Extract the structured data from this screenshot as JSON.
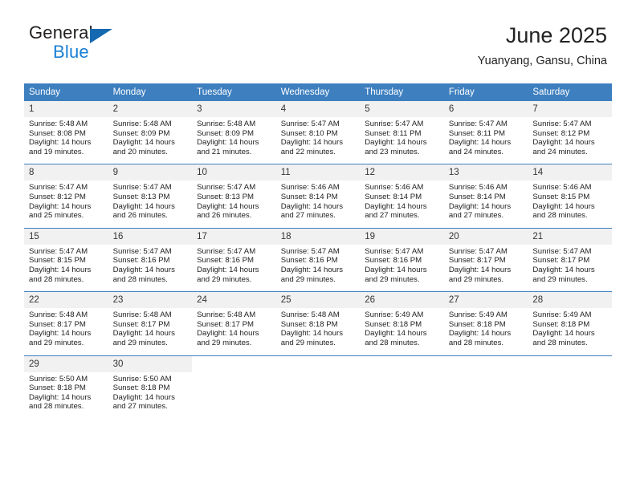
{
  "brand": {
    "name_top": "General",
    "name_bottom": "Blue",
    "accent_blue": "#1a7fd4",
    "triangle_blue": "#1569b0"
  },
  "header": {
    "title": "June 2025",
    "subtitle": "Yuanyang, Gansu, China"
  },
  "calendar": {
    "header_bg": "#3d7fbf",
    "daynum_bg": "#f1f1f1",
    "weekdays": [
      "Sunday",
      "Monday",
      "Tuesday",
      "Wednesday",
      "Thursday",
      "Friday",
      "Saturday"
    ],
    "weeks": [
      {
        "days": [
          {
            "num": "1",
            "sunrise": "Sunrise: 5:48 AM",
            "sunset": "Sunset: 8:08 PM",
            "daylight1": "Daylight: 14 hours",
            "daylight2": "and 19 minutes."
          },
          {
            "num": "2",
            "sunrise": "Sunrise: 5:48 AM",
            "sunset": "Sunset: 8:09 PM",
            "daylight1": "Daylight: 14 hours",
            "daylight2": "and 20 minutes."
          },
          {
            "num": "3",
            "sunrise": "Sunrise: 5:48 AM",
            "sunset": "Sunset: 8:09 PM",
            "daylight1": "Daylight: 14 hours",
            "daylight2": "and 21 minutes."
          },
          {
            "num": "4",
            "sunrise": "Sunrise: 5:47 AM",
            "sunset": "Sunset: 8:10 PM",
            "daylight1": "Daylight: 14 hours",
            "daylight2": "and 22 minutes."
          },
          {
            "num": "5",
            "sunrise": "Sunrise: 5:47 AM",
            "sunset": "Sunset: 8:11 PM",
            "daylight1": "Daylight: 14 hours",
            "daylight2": "and 23 minutes."
          },
          {
            "num": "6",
            "sunrise": "Sunrise: 5:47 AM",
            "sunset": "Sunset: 8:11 PM",
            "daylight1": "Daylight: 14 hours",
            "daylight2": "and 24 minutes."
          },
          {
            "num": "7",
            "sunrise": "Sunrise: 5:47 AM",
            "sunset": "Sunset: 8:12 PM",
            "daylight1": "Daylight: 14 hours",
            "daylight2": "and 24 minutes."
          }
        ]
      },
      {
        "days": [
          {
            "num": "8",
            "sunrise": "Sunrise: 5:47 AM",
            "sunset": "Sunset: 8:12 PM",
            "daylight1": "Daylight: 14 hours",
            "daylight2": "and 25 minutes."
          },
          {
            "num": "9",
            "sunrise": "Sunrise: 5:47 AM",
            "sunset": "Sunset: 8:13 PM",
            "daylight1": "Daylight: 14 hours",
            "daylight2": "and 26 minutes."
          },
          {
            "num": "10",
            "sunrise": "Sunrise: 5:47 AM",
            "sunset": "Sunset: 8:13 PM",
            "daylight1": "Daylight: 14 hours",
            "daylight2": "and 26 minutes."
          },
          {
            "num": "11",
            "sunrise": "Sunrise: 5:46 AM",
            "sunset": "Sunset: 8:14 PM",
            "daylight1": "Daylight: 14 hours",
            "daylight2": "and 27 minutes."
          },
          {
            "num": "12",
            "sunrise": "Sunrise: 5:46 AM",
            "sunset": "Sunset: 8:14 PM",
            "daylight1": "Daylight: 14 hours",
            "daylight2": "and 27 minutes."
          },
          {
            "num": "13",
            "sunrise": "Sunrise: 5:46 AM",
            "sunset": "Sunset: 8:14 PM",
            "daylight1": "Daylight: 14 hours",
            "daylight2": "and 27 minutes."
          },
          {
            "num": "14",
            "sunrise": "Sunrise: 5:46 AM",
            "sunset": "Sunset: 8:15 PM",
            "daylight1": "Daylight: 14 hours",
            "daylight2": "and 28 minutes."
          }
        ]
      },
      {
        "days": [
          {
            "num": "15",
            "sunrise": "Sunrise: 5:47 AM",
            "sunset": "Sunset: 8:15 PM",
            "daylight1": "Daylight: 14 hours",
            "daylight2": "and 28 minutes."
          },
          {
            "num": "16",
            "sunrise": "Sunrise: 5:47 AM",
            "sunset": "Sunset: 8:16 PM",
            "daylight1": "Daylight: 14 hours",
            "daylight2": "and 28 minutes."
          },
          {
            "num": "17",
            "sunrise": "Sunrise: 5:47 AM",
            "sunset": "Sunset: 8:16 PM",
            "daylight1": "Daylight: 14 hours",
            "daylight2": "and 29 minutes."
          },
          {
            "num": "18",
            "sunrise": "Sunrise: 5:47 AM",
            "sunset": "Sunset: 8:16 PM",
            "daylight1": "Daylight: 14 hours",
            "daylight2": "and 29 minutes."
          },
          {
            "num": "19",
            "sunrise": "Sunrise: 5:47 AM",
            "sunset": "Sunset: 8:16 PM",
            "daylight1": "Daylight: 14 hours",
            "daylight2": "and 29 minutes."
          },
          {
            "num": "20",
            "sunrise": "Sunrise: 5:47 AM",
            "sunset": "Sunset: 8:17 PM",
            "daylight1": "Daylight: 14 hours",
            "daylight2": "and 29 minutes."
          },
          {
            "num": "21",
            "sunrise": "Sunrise: 5:47 AM",
            "sunset": "Sunset: 8:17 PM",
            "daylight1": "Daylight: 14 hours",
            "daylight2": "and 29 minutes."
          }
        ]
      },
      {
        "days": [
          {
            "num": "22",
            "sunrise": "Sunrise: 5:48 AM",
            "sunset": "Sunset: 8:17 PM",
            "daylight1": "Daylight: 14 hours",
            "daylight2": "and 29 minutes."
          },
          {
            "num": "23",
            "sunrise": "Sunrise: 5:48 AM",
            "sunset": "Sunset: 8:17 PM",
            "daylight1": "Daylight: 14 hours",
            "daylight2": "and 29 minutes."
          },
          {
            "num": "24",
            "sunrise": "Sunrise: 5:48 AM",
            "sunset": "Sunset: 8:17 PM",
            "daylight1": "Daylight: 14 hours",
            "daylight2": "and 29 minutes."
          },
          {
            "num": "25",
            "sunrise": "Sunrise: 5:48 AM",
            "sunset": "Sunset: 8:18 PM",
            "daylight1": "Daylight: 14 hours",
            "daylight2": "and 29 minutes."
          },
          {
            "num": "26",
            "sunrise": "Sunrise: 5:49 AM",
            "sunset": "Sunset: 8:18 PM",
            "daylight1": "Daylight: 14 hours",
            "daylight2": "and 28 minutes."
          },
          {
            "num": "27",
            "sunrise": "Sunrise: 5:49 AM",
            "sunset": "Sunset: 8:18 PM",
            "daylight1": "Daylight: 14 hours",
            "daylight2": "and 28 minutes."
          },
          {
            "num": "28",
            "sunrise": "Sunrise: 5:49 AM",
            "sunset": "Sunset: 8:18 PM",
            "daylight1": "Daylight: 14 hours",
            "daylight2": "and 28 minutes."
          }
        ]
      },
      {
        "days": [
          {
            "num": "29",
            "sunrise": "Sunrise: 5:50 AM",
            "sunset": "Sunset: 8:18 PM",
            "daylight1": "Daylight: 14 hours",
            "daylight2": "and 28 minutes."
          },
          {
            "num": "30",
            "sunrise": "Sunrise: 5:50 AM",
            "sunset": "Sunset: 8:18 PM",
            "daylight1": "Daylight: 14 hours",
            "daylight2": "and 27 minutes."
          },
          {
            "num": "",
            "sunrise": "",
            "sunset": "",
            "daylight1": "",
            "daylight2": ""
          },
          {
            "num": "",
            "sunrise": "",
            "sunset": "",
            "daylight1": "",
            "daylight2": ""
          },
          {
            "num": "",
            "sunrise": "",
            "sunset": "",
            "daylight1": "",
            "daylight2": ""
          },
          {
            "num": "",
            "sunrise": "",
            "sunset": "",
            "daylight1": "",
            "daylight2": ""
          },
          {
            "num": "",
            "sunrise": "",
            "sunset": "",
            "daylight1": "",
            "daylight2": ""
          }
        ]
      }
    ]
  }
}
